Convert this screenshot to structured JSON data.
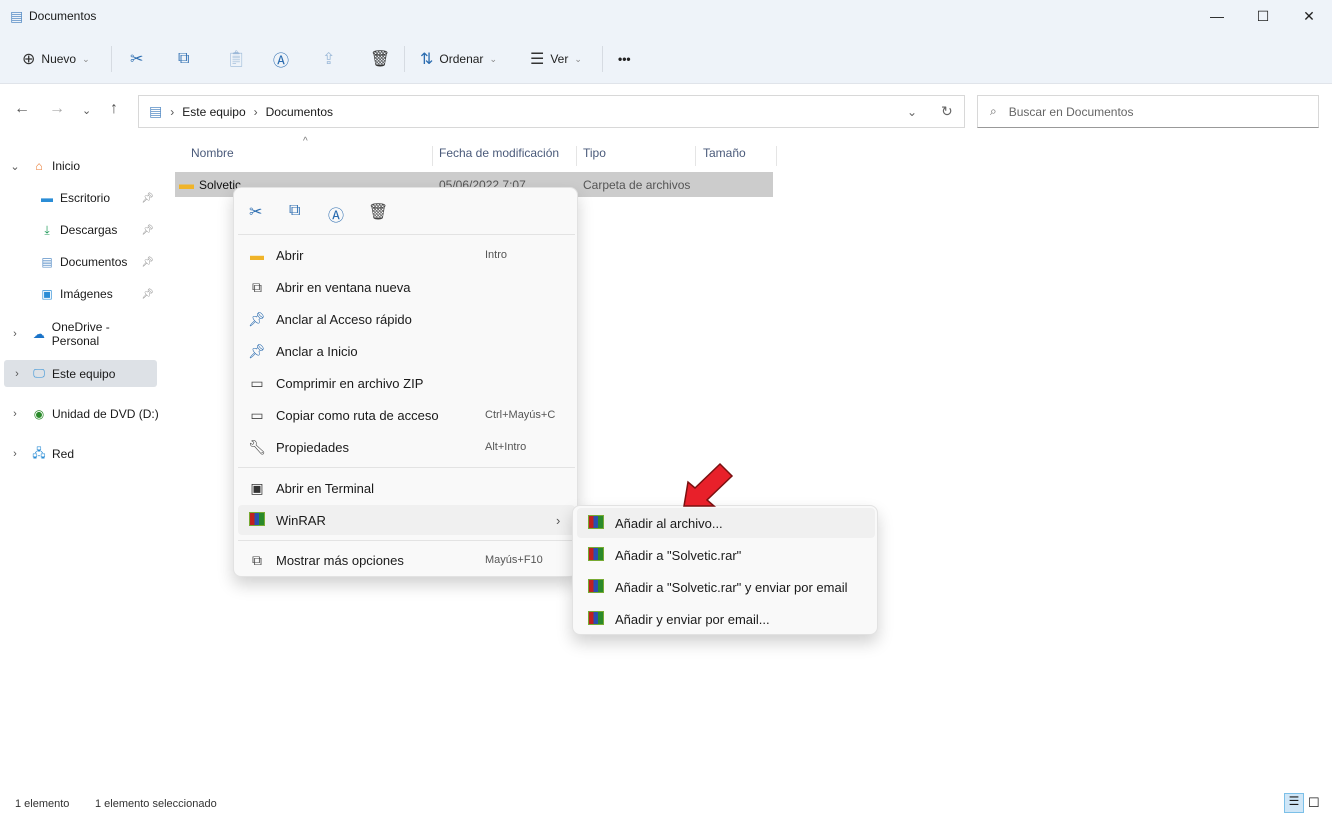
{
  "window": {
    "title": "Documentos",
    "minimize": "—",
    "maximize": "☐",
    "close": "✕"
  },
  "toolbar": {
    "new": "Nuevo",
    "sort": "Ordenar",
    "view": "Ver",
    "more": "•••"
  },
  "address": {
    "crumbs": [
      "Este equipo",
      "Documentos"
    ]
  },
  "search": {
    "placeholder": "Buscar en Documentos"
  },
  "sidebar": {
    "items": [
      {
        "label": "Inicio"
      },
      {
        "label": "Escritorio"
      },
      {
        "label": "Descargas"
      },
      {
        "label": "Documentos"
      },
      {
        "label": "Imágenes"
      },
      {
        "label": "OneDrive - Personal"
      },
      {
        "label": "Este equipo"
      },
      {
        "label": "Unidad de DVD (D:)"
      },
      {
        "label": "Red"
      }
    ]
  },
  "columns": [
    "Nombre",
    "Fecha de modificación",
    "Tipo",
    "Tamaño"
  ],
  "files": [
    {
      "name": "Solvetic",
      "date": "05/06/2022 7:07",
      "type": "Carpeta de archivos"
    }
  ],
  "context_menu": {
    "items": [
      {
        "label": "Abrir",
        "shortcut": "Intro"
      },
      {
        "label": "Abrir en ventana nueva",
        "shortcut": ""
      },
      {
        "label": "Anclar al Acceso rápido",
        "shortcut": ""
      },
      {
        "label": "Anclar a Inicio",
        "shortcut": ""
      },
      {
        "label": "Comprimir en archivo ZIP",
        "shortcut": ""
      },
      {
        "label": "Copiar como ruta de acceso",
        "shortcut": "Ctrl+Mayús+C"
      },
      {
        "label": "Propiedades",
        "shortcut": "Alt+Intro"
      },
      {
        "label": "Abrir en Terminal",
        "shortcut": ""
      },
      {
        "label": "WinRAR",
        "shortcut": ""
      },
      {
        "label": "Mostrar más opciones",
        "shortcut": "Mayús+F10"
      }
    ]
  },
  "winrar_submenu": {
    "items": [
      {
        "label": "Añadir al archivo..."
      },
      {
        "label": "Añadir a \"Solvetic.rar\""
      },
      {
        "label": "Añadir a \"Solvetic.rar\" y enviar por email"
      },
      {
        "label": "Añadir y enviar por email..."
      }
    ]
  },
  "status": {
    "count": "1 elemento",
    "selected": "1 elemento seleccionado"
  },
  "colors": {
    "accent": "#2b6cb0",
    "arrow": "#e8202a",
    "selection": "#cccccc"
  }
}
